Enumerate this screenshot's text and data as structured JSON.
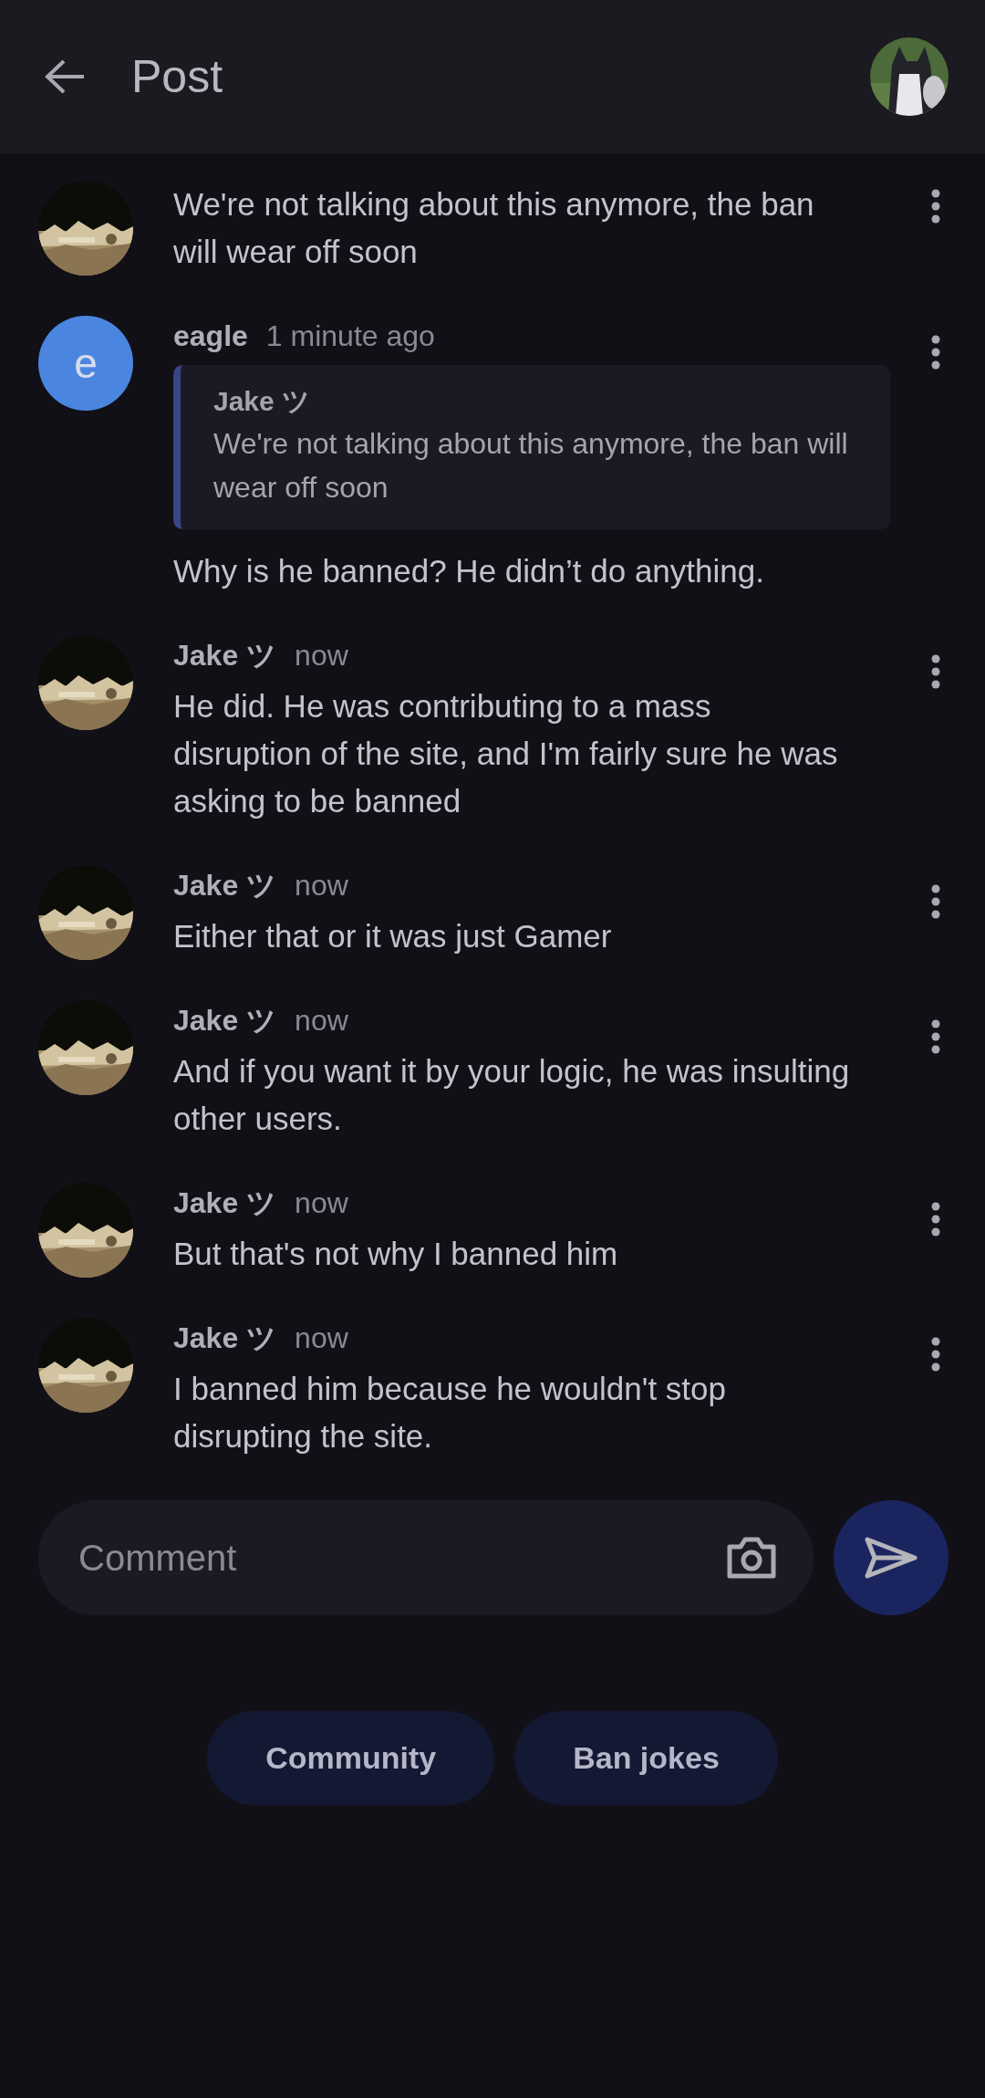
{
  "header": {
    "title": "Post"
  },
  "comments": [
    {
      "text": "We're not talking about this anymore, the ban will wear off soon"
    },
    {
      "avatar": {
        "kind": "letter",
        "letter": "e",
        "color": "#4a86e0"
      },
      "author": "eagle",
      "time": "1 minute ago",
      "quote": {
        "author": "Jake ツ",
        "text": "We're not talking about this anymore, the ban will wear off soon"
      },
      "text": "Why is he banned? He didn’t do anything."
    },
    {
      "author": "Jake ツ",
      "time": "now",
      "text": "He did. He was contributing to a mass disruption of the site, and I'm fairly sure he was asking to be banned"
    },
    {
      "author": "Jake ツ",
      "time": "now",
      "text": "Either that or it was just Gamer"
    },
    {
      "author": "Jake ツ",
      "time": "now",
      "text": "And if you want it by your logic, he was insulting other users."
    },
    {
      "author": "Jake ツ",
      "time": "now",
      "text": "But that's not why I banned him"
    },
    {
      "author": "Jake ツ",
      "time": "now",
      "text": "I banned him because he wouldn't stop disrupting the site."
    }
  ],
  "composer": {
    "placeholder": "Comment"
  },
  "tags": [
    "Community",
    "Ban jokes"
  ]
}
